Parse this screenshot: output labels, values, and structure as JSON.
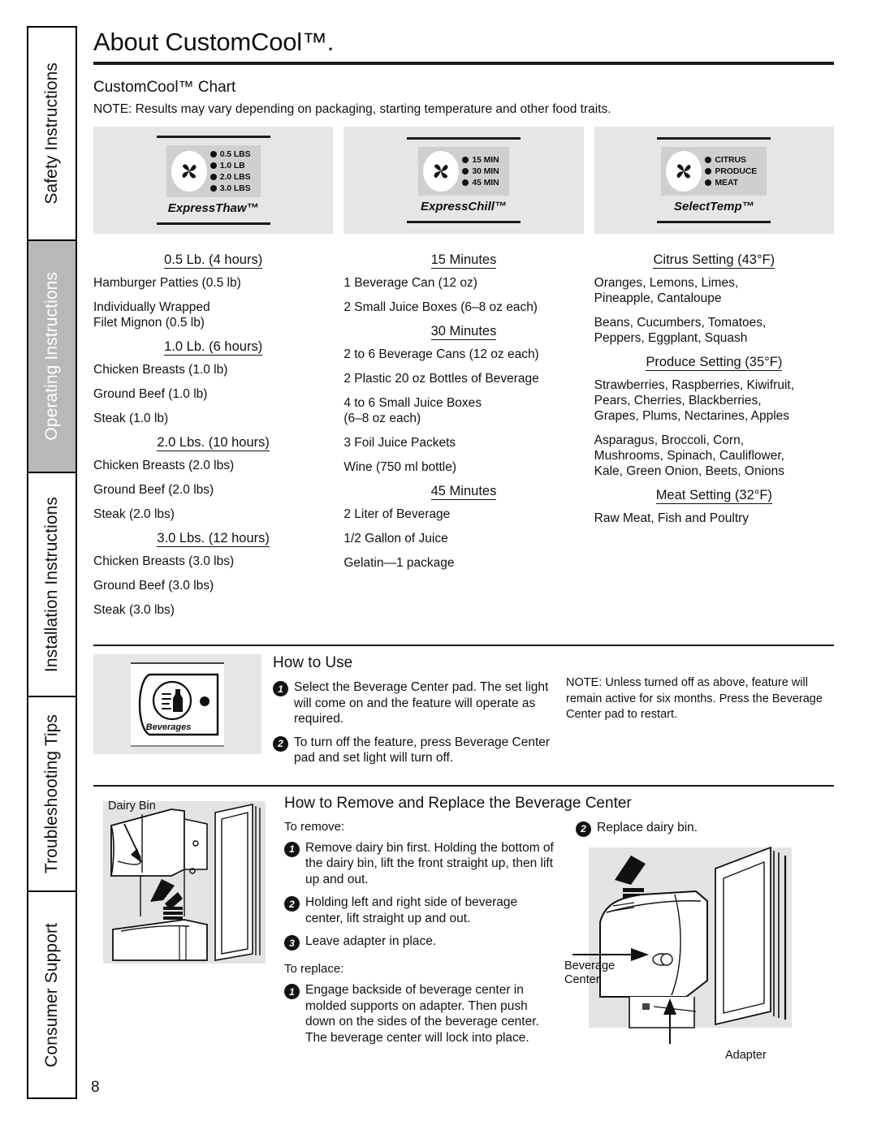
{
  "sidebar": {
    "tabs": [
      {
        "label": "Safety Instructions",
        "active": false
      },
      {
        "label": "Operating Instructions",
        "active": true
      },
      {
        "label": "Installation Instructions",
        "active": false
      },
      {
        "label": "Troubleshooting Tips",
        "active": false
      },
      {
        "label": "Consumer Support",
        "active": false
      }
    ]
  },
  "header": {
    "title": "About CustomCool™.",
    "section_heading": "CustomCool™ Chart",
    "note": "NOTE: Results may vary depending on packaging, starting temperature and other food traits."
  },
  "badges": [
    {
      "name": "ExpressThaw™",
      "icon": "fan-icon",
      "leds": [
        "0.5 LBS",
        "1.0 LB",
        "2.0 LBS",
        "3.0 LBS"
      ]
    },
    {
      "name": "ExpressChill™",
      "icon": "fan-icon",
      "leds": [
        "15 MIN",
        "30 MIN",
        "45 MIN"
      ]
    },
    {
      "name": "SelectTemp™",
      "icon": "fan-icon",
      "leds": [
        "CITRUS",
        "PRODUCE",
        "MEAT"
      ]
    }
  ],
  "chart_data": {
    "type": "table",
    "title": "CustomCool™ Chart",
    "columns": [
      {
        "name": "ExpressThaw",
        "groups": [
          {
            "heading": "0.5 Lb. (4 hours)",
            "items": [
              "Hamburger Patties (0.5 lb)",
              "Individually Wrapped\nFilet Mignon (0.5 lb)"
            ]
          },
          {
            "heading": "1.0 Lb. (6 hours)",
            "items": [
              "Chicken Breasts (1.0 lb)",
              "Ground Beef (1.0 lb)",
              "Steak (1.0 lb)"
            ]
          },
          {
            "heading": "2.0 Lbs. (10 hours)",
            "items": [
              "Chicken Breasts (2.0 lbs)",
              "Ground Beef (2.0 lbs)",
              "Steak (2.0 lbs)"
            ]
          },
          {
            "heading": "3.0 Lbs. (12 hours)",
            "items": [
              "Chicken Breasts (3.0 lbs)",
              "Ground Beef (3.0 lbs)",
              "Steak (3.0 lbs)"
            ]
          }
        ]
      },
      {
        "name": "ExpressChill",
        "groups": [
          {
            "heading": "15 Minutes",
            "items": [
              "1 Beverage Can (12 oz)",
              "2 Small Juice Boxes (6–8 oz each)"
            ]
          },
          {
            "heading": "30 Minutes",
            "items": [
              "2 to 6 Beverage Cans (12 oz each)",
              "2 Plastic 20 oz Bottles of Beverage",
              "4 to 6 Small Juice Boxes\n(6–8 oz each)",
              "3 Foil Juice Packets",
              "Wine (750 ml bottle)"
            ]
          },
          {
            "heading": "45 Minutes",
            "items": [
              "2 Liter of Beverage",
              "1/2 Gallon of Juice",
              "Gelatin—1 package"
            ]
          }
        ]
      },
      {
        "name": "SelectTemp",
        "groups": [
          {
            "heading": "Citrus Setting (43°F)",
            "items": [
              "Oranges, Lemons, Limes,\nPineapple, Cantaloupe",
              "Beans, Cucumbers, Tomatoes,\nPeppers, Eggplant, Squash"
            ]
          },
          {
            "heading": "Produce Setting (35°F)",
            "items": [
              "Strawberries, Raspberries, Kiwifruit,\nPears, Cherries, Blackberries,\nGrapes, Plums, Nectarines, Apples",
              "Asparagus, Broccoli, Corn,\nMushrooms, Spinach, Cauliflower,\nKale, Green Onion, Beets, Onions"
            ]
          },
          {
            "heading": "Meat Setting (32°F)",
            "items": [
              "Raw Meat, Fish and Poultry"
            ]
          }
        ]
      }
    ]
  },
  "how_to_use": {
    "title": "How to Use",
    "pad_label": "Beverages",
    "steps": [
      {
        "num": "1",
        "text": "Select the Beverage Center pad. The set light will come on and the feature will operate as required."
      },
      {
        "num": "2",
        "text": "To turn off the feature, press Beverage Center pad and set light will turn off."
      }
    ],
    "note": "NOTE: Unless turned off as above, feature will remain active for six months. Press the Beverage Center pad to restart."
  },
  "remove_replace": {
    "title": "How to Remove and Replace the Beverage Center",
    "to_remove_label": "To remove:",
    "remove_steps": [
      {
        "num": "1",
        "text": "Remove dairy bin first. Holding the bottom of the dairy bin, lift the front straight up, then lift up and out."
      },
      {
        "num": "2",
        "text": "Holding left and right side of beverage center, lift straight up and out."
      },
      {
        "num": "3",
        "text": "Leave adapter in place."
      }
    ],
    "to_replace_label": "To replace:",
    "replace_steps": [
      {
        "num": "1",
        "text": "Engage backside of beverage center in molded supports on adapter. Then push down on the sides of the beverage center. The beverage center will lock into place."
      },
      {
        "num": "2",
        "text": "Replace dairy bin."
      }
    ],
    "fig_labels": {
      "dairy_bin": "Dairy Bin",
      "beverage_center": "Beverage\nCenter",
      "adapter": "Adapter"
    }
  },
  "page_number": "8"
}
